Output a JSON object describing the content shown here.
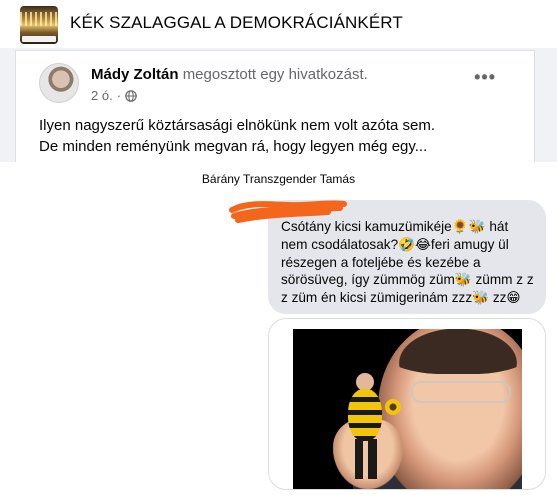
{
  "group": {
    "title": "KÉK SZALAGGAL A DEMOKRÁCIÁNKÉRT",
    "avatar_icon": "group-cover-photo"
  },
  "post": {
    "author": "Mády Zoltán",
    "action": "megosztott egy hivatkozást.",
    "time": "2 ó.",
    "privacy_icon": "globe-icon",
    "more_label": "•••",
    "text_line1": "Ilyen nagyszerű köztársasági elnökünk nem volt azóta sem.",
    "text_line2": "De minden reményünk megvan rá, hogy legyen még egy..."
  },
  "chat": {
    "title": "Bárány Transzgender Tamás",
    "message": "Csótány kicsi kamuzümikéje🌻🐝 hát nem csodálatosak?🤣😂feri amugy ül részegen a foteljébe és kezébe a sörösüveg, így zümmög züm🐝 zümm z z z züm én kicsi zümigerinám zzz🐝 zz😁"
  },
  "colors": {
    "bubble": "#e4e6eb",
    "scribble": "#f4661b",
    "secondary_text": "#65676b"
  }
}
